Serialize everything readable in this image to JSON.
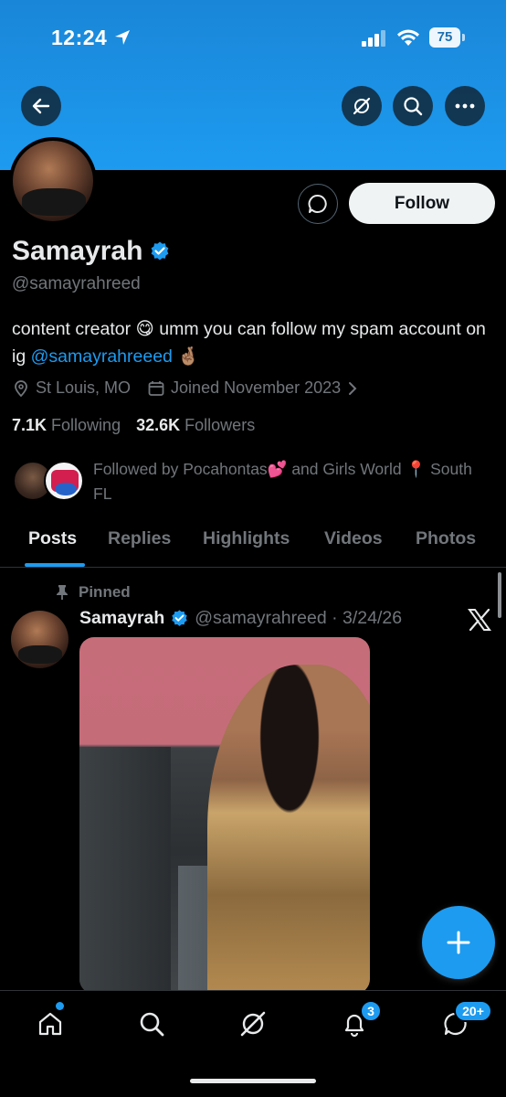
{
  "status_bar": {
    "time": "12:24",
    "battery": "75"
  },
  "profile": {
    "name": "Samayrah",
    "handle": "@samayrahreed",
    "bio_text": "content creator 😋 umm you can follow my spam account on ig ",
    "bio_link": "@samayrahreeed",
    "bio_emoji": "🤞🏽",
    "location": "St Louis, MO",
    "joined": "Joined November 2023",
    "following_count": "7.1K",
    "following_label": "Following",
    "followers_count": "32.6K",
    "followers_label": "Followers",
    "followed_by": "Followed by Pocahontas💕 and Girls World 📍 South FL",
    "follow_button": "Follow"
  },
  "tabs": [
    "Posts",
    "Replies",
    "Highlights",
    "Videos",
    "Photos"
  ],
  "active_tab": "Posts",
  "post": {
    "pinned_label": "Pinned",
    "author": "Samayrah",
    "handle_date": "@samayrahreed · 3/24/26"
  },
  "bottom_nav": {
    "items": [
      "home-icon",
      "search-icon",
      "grok-icon",
      "notifications-icon",
      "messages-icon"
    ],
    "notifications_badge": "3",
    "messages_badge": "20+"
  },
  "colors": {
    "accent": "#1d9bf0",
    "background": "#000000",
    "muted": "#71767b",
    "text": "#e7e9ea"
  }
}
